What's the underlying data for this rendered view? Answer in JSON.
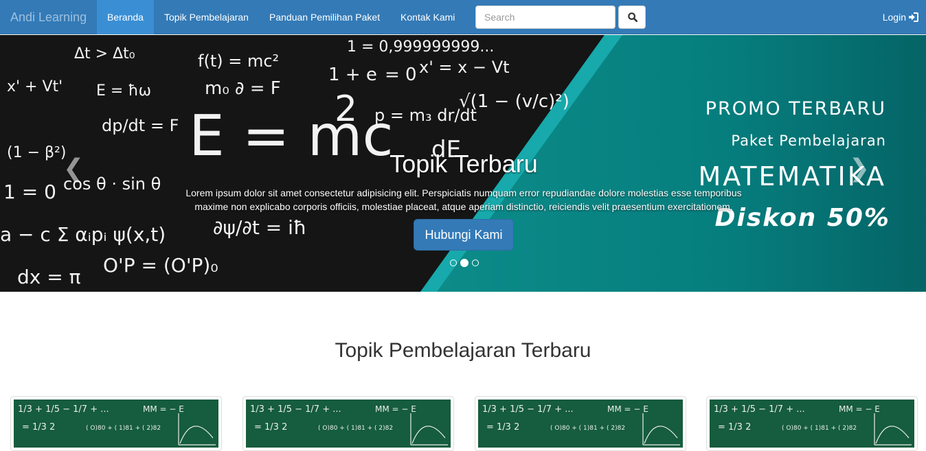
{
  "navbar": {
    "brand": "Andi Learning",
    "items": [
      {
        "label": "Beranda",
        "active": true
      },
      {
        "label": "Topik Pembelajaran",
        "active": false
      },
      {
        "label": "Panduan Pemilihan Paket",
        "active": false
      },
      {
        "label": "Kontak Kami",
        "active": false
      }
    ],
    "search_placeholder": "Search",
    "search_icon": "search-icon",
    "login_label": "Login",
    "login_icon": "log-in-icon"
  },
  "carousel": {
    "promo_line1": "PROMO TERBARU",
    "promo_line2": "Paket Pembelajaran",
    "promo_line3": "MATEMATIKA",
    "promo_line4": "Diskon 50%",
    "chalk": {
      "emc": "E = mc",
      "emc_exp": "2",
      "f1": "1 = 0,999999999...",
      "f2": "1 + e",
      "f3": "= 0",
      "f4": "x' = x − Vt",
      "f5": "p = m₃ dr/dt",
      "f6": "dp/dt = F",
      "f7": "1 = 0",
      "f8": "cos θ · sin θ",
      "f9": "O'P = (O'P)₀",
      "f10": "dx = π",
      "f11": "E = ħω",
      "f12": "m₀ ∂ = F",
      "f13": "√(1 − (v/c)²)",
      "f14": "a − c Σ αᵢpᵢ ψ(x,t)",
      "f15": "∂ψ/∂t = iħ",
      "f16": "dE",
      "f17": "Δt > Δt₀",
      "f18": "x' + Vt'",
      "f19": "(1 − β²)",
      "f20": "f(t) = mc²"
    },
    "caption_title": "Topik Terbaru",
    "caption_text": "Lorem ipsum dolor sit amet consectetur adipisicing elit. Perspiciatis numquam error repudiandae dolore molestias esse temporibus maxime non explicabo corporis officiis, molestiae placeat, atque aperiam distinctio, reiciendis velit praesentium exercitationem.",
    "cta_label": "Hubungi Kami",
    "prev_icon": "chevron-left-icon",
    "next_icon": "chevron-right-icon",
    "indicators": [
      false,
      true,
      false
    ]
  },
  "section": {
    "title": "Topik Pembelajaran Terbaru",
    "cards": [
      {
        "line1": "1/3 + 1/5 − 1/7 + ...",
        "line2": "= 1/3     2",
        "line3": "MM = −     E",
        "line4": "(  O)80 + (  1)81 + (  2)82"
      },
      {
        "line1": "1/3 + 1/5 − 1/7 + ...",
        "line2": "= 1/3     2",
        "line3": "MM = −     E",
        "line4": "(  O)80 + (  1)81 + (  2)82"
      },
      {
        "line1": "1/3 + 1/5 − 1/7 + ...",
        "line2": "= 1/3     2",
        "line3": "MM = −     E",
        "line4": "(  O)80 + (  1)81 + (  2)82"
      },
      {
        "line1": "1/3 + 1/5 − 1/7 + ...",
        "line2": "= 1/3     2",
        "line3": "MM = −     E",
        "line4": "(  O)80 + (  1)81 + (  2)82"
      }
    ]
  },
  "colors": {
    "navbar": "#337ab7",
    "nav_active": "#3a8fd4",
    "promo_teal": "#078a88",
    "card_thumb": "#165c3e"
  }
}
